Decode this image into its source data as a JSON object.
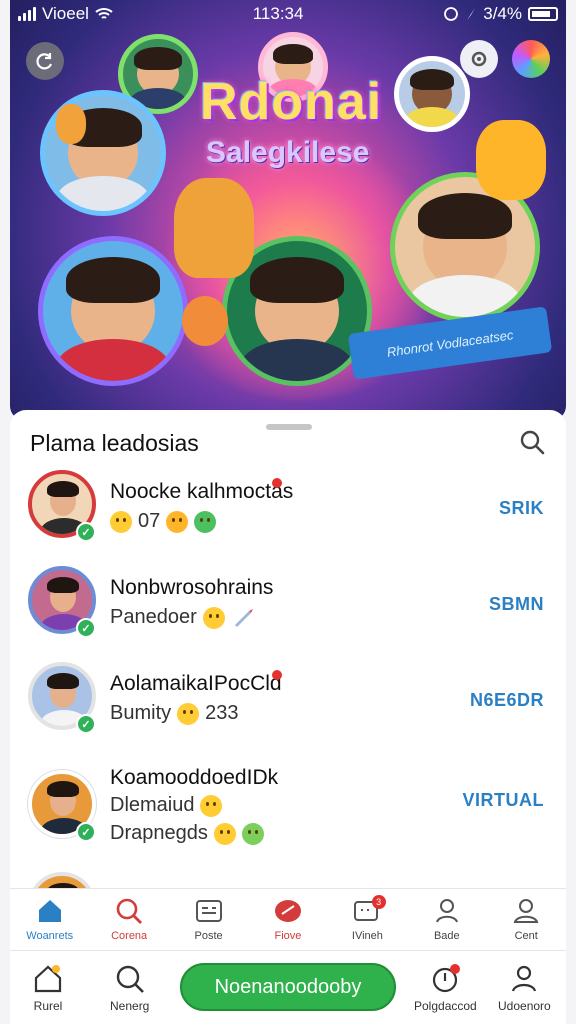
{
  "status_bar": {
    "carrier": "Vioeel",
    "time": "113:34",
    "battery": "3/4%"
  },
  "hero": {
    "title": "Rdonai",
    "subtitle": "Salegkilese",
    "ribbon": "Rhonrot Vodlaceatsec"
  },
  "sheet": {
    "title": "Plama leadosias",
    "rows": [
      {
        "name": "Noocke kalhmoctas",
        "sub": "07",
        "tag": "SRIK",
        "ring": "#d53b3b"
      },
      {
        "name": "Nonbwrosohrains",
        "sub": "Panedoer",
        "tag": "SBMN",
        "ring": "#6d8cd6"
      },
      {
        "name": "AolamaikaIPocCld",
        "sub": "Bumity",
        "sub_value": "233",
        "tag": "N6E6DR",
        "ring": "#e3e3e3"
      },
      {
        "name": "KoamooddoedIDk",
        "sub": "Dlemaiud",
        "sub2": "Drapnegds",
        "tag": "VIRTUAL",
        "ring": "#ffffff"
      }
    ]
  },
  "tabbar_top": [
    {
      "label": "Woanrets",
      "icon": "home-icon",
      "active": true
    },
    {
      "label": "Corena",
      "icon": "search-icon",
      "active": false
    },
    {
      "label": "Poste",
      "icon": "calendar-icon",
      "active": false
    },
    {
      "label": "Fiove",
      "icon": "heart-icon",
      "active": false
    },
    {
      "label": "IVineh",
      "icon": "chat-icon",
      "active": false,
      "badge": "3"
    },
    {
      "label": "Bade",
      "icon": "person-icon",
      "active": false
    },
    {
      "label": "Cent",
      "icon": "profile-icon",
      "active": false
    }
  ],
  "tabbar_bottom": {
    "left1": "Rurel",
    "left2": "Nenerg",
    "cta": "Noenanoodooby",
    "right1": "Polgdaccod",
    "right2": "Udoenoro"
  },
  "colors": {
    "accent_blue": "#2b7fc3",
    "cta_green": "#2fb14c",
    "badge_red": "#e33030"
  }
}
